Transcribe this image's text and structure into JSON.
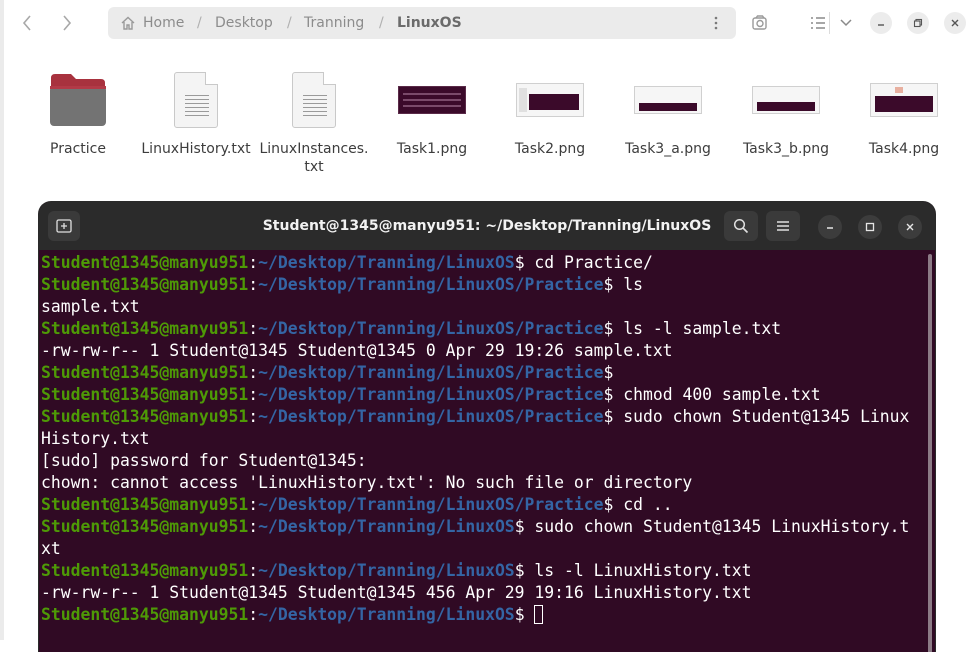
{
  "file_manager": {
    "breadcrumb": [
      "Home",
      "Desktop",
      "Tranning",
      "LinuxOS"
    ],
    "files": [
      {
        "name": "Practice",
        "kind": "folder"
      },
      {
        "name": "LinuxHistory.txt",
        "kind": "text"
      },
      {
        "name": "LinuxInstances.txt",
        "kind": "text"
      },
      {
        "name": "Task1.png",
        "kind": "image"
      },
      {
        "name": "Task2.png",
        "kind": "image"
      },
      {
        "name": "Task3_a.png",
        "kind": "image"
      },
      {
        "name": "Task3_b.png",
        "kind": "image"
      },
      {
        "name": "Task4.png",
        "kind": "image"
      }
    ]
  },
  "terminal": {
    "title": "Student@1345@manyu951: ~/Desktop/Tranning/LinuxOS",
    "colors": {
      "background": "#300a24",
      "user": "#4e9a06",
      "path": "#3465a4",
      "header": "#2b2b2b"
    },
    "lines": [
      {
        "user": "Student@1345@manyu951",
        "path": "~/Desktop/Tranning/LinuxOS",
        "cmd": " cd Practice/"
      },
      {
        "user": "Student@1345@manyu951",
        "path": "~/Desktop/Tranning/LinuxOS/Practice",
        "cmd": " ls"
      },
      {
        "text": "sample.txt"
      },
      {
        "user": "Student@1345@manyu951",
        "path": "~/Desktop/Tranning/LinuxOS/Practice",
        "cmd": " ls -l sample.txt"
      },
      {
        "text": "-rw-rw-r-- 1 Student@1345 Student@1345 0 Apr 29 19:26 sample.txt"
      },
      {
        "user": "Student@1345@manyu951",
        "path": "~/Desktop/Tranning/LinuxOS/Practice",
        "cmd": ""
      },
      {
        "user": "Student@1345@manyu951",
        "path": "~/Desktop/Tranning/LinuxOS/Practice",
        "cmd": " chmod 400 sample.txt"
      },
      {
        "user": "Student@1345@manyu951",
        "path": "~/Desktop/Tranning/LinuxOS/Practice",
        "cmd": " sudo chown Student@1345 Linux"
      },
      {
        "text": "History.txt"
      },
      {
        "text": "[sudo] password for Student@1345:"
      },
      {
        "text": "chown: cannot access 'LinuxHistory.txt': No such file or directory"
      },
      {
        "user": "Student@1345@manyu951",
        "path": "~/Desktop/Tranning/LinuxOS/Practice",
        "cmd": " cd .."
      },
      {
        "user": "Student@1345@manyu951",
        "path": "~/Desktop/Tranning/LinuxOS",
        "cmd": " sudo chown Student@1345 LinuxHistory.t"
      },
      {
        "text": "xt"
      },
      {
        "user": "Student@1345@manyu951",
        "path": "~/Desktop/Tranning/LinuxOS",
        "cmd": " ls -l LinuxHistory.txt"
      },
      {
        "text": "-rw-rw-r-- 1 Student@1345 Student@1345 456 Apr 29 19:16 LinuxHistory.txt"
      },
      {
        "user": "Student@1345@manyu951",
        "path": "~/Desktop/Tranning/LinuxOS",
        "cmd": " ",
        "cursor": true
      }
    ]
  }
}
